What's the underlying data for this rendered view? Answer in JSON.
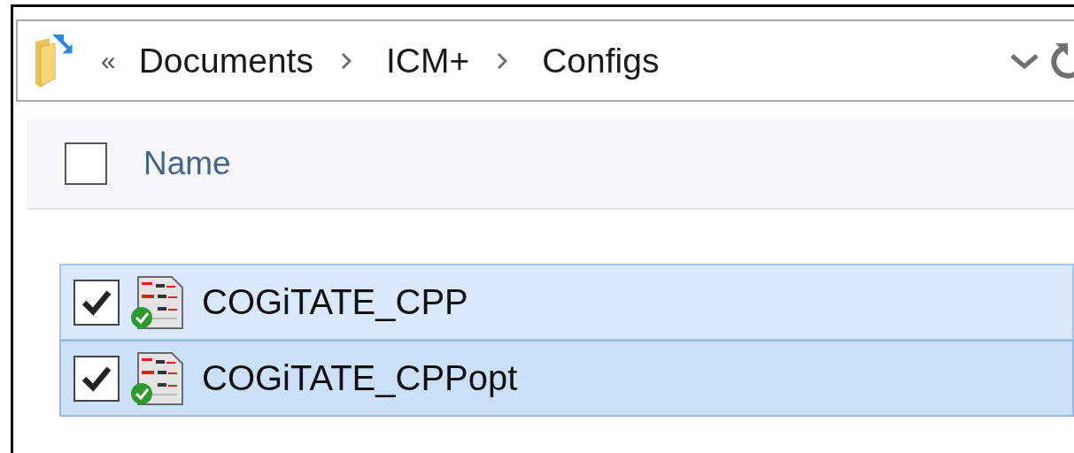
{
  "address_bar": {
    "overflow": "«",
    "path": [
      "Documents",
      "ICM+",
      "Configs"
    ]
  },
  "header": {
    "select_all_checked": false,
    "column": "Name"
  },
  "files": [
    {
      "name": "COGiTATE_CPP",
      "selected": true,
      "checked": true,
      "hot": false
    },
    {
      "name": "COGiTATE_CPPopt",
      "selected": true,
      "checked": true,
      "hot": true
    }
  ]
}
